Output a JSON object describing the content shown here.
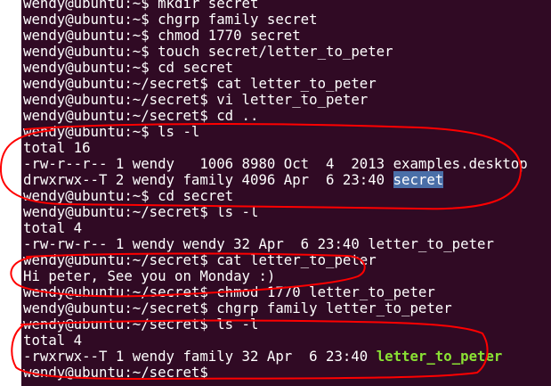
{
  "terminal": {
    "background": "#300a24",
    "text_color": "#ffffff",
    "highlight_color": "#4a6fa8",
    "executable_color": "#8ae234",
    "lines": [
      {
        "segments": [
          {
            "text": "wendy@ubuntu:~$ mkdir secret",
            "style": "normal"
          }
        ]
      },
      {
        "segments": [
          {
            "text": "wendy@ubuntu:~$ chgrp family secret",
            "style": "normal"
          }
        ]
      },
      {
        "segments": [
          {
            "text": "wendy@ubuntu:~$ chmod 1770 secret",
            "style": "normal"
          }
        ]
      },
      {
        "segments": [
          {
            "text": "wendy@ubuntu:~$ touch secret/letter_to_peter",
            "style": "normal"
          }
        ]
      },
      {
        "segments": [
          {
            "text": "wendy@ubuntu:~$ cd secret",
            "style": "normal"
          }
        ]
      },
      {
        "segments": [
          {
            "text": "wendy@ubuntu:~/secret$ cat letter_to_peter",
            "style": "normal"
          }
        ]
      },
      {
        "segments": [
          {
            "text": "wendy@ubuntu:~/secret$ vi letter_to_peter",
            "style": "normal"
          }
        ]
      },
      {
        "segments": [
          {
            "text": "wendy@ubuntu:~/secret$ cd ..",
            "style": "normal"
          }
        ]
      },
      {
        "segments": [
          {
            "text": "wendy@ubuntu:~$ ls -l",
            "style": "normal"
          }
        ]
      },
      {
        "segments": [
          {
            "text": "total 16",
            "style": "normal"
          }
        ]
      },
      {
        "segments": [
          {
            "text": "-rw-r--r-- 1 wendy   1006 8980 Oct  4  2013 examples.desktop",
            "style": "normal"
          }
        ]
      },
      {
        "segments": [
          {
            "text": "drwxrwx--T 2 wendy family 4096 Apr  6 23:40 ",
            "style": "normal"
          },
          {
            "text": "secret",
            "style": "highlight"
          }
        ]
      },
      {
        "segments": [
          {
            "text": "wendy@ubuntu:~$ cd secret",
            "style": "normal"
          }
        ]
      },
      {
        "segments": [
          {
            "text": "wendy@ubuntu:~/secret$ ls -l",
            "style": "normal"
          }
        ]
      },
      {
        "segments": [
          {
            "text": "total 4",
            "style": "normal"
          }
        ]
      },
      {
        "segments": [
          {
            "text": "-rw-rw-r-- 1 wendy wendy 32 Apr  6 23:40 letter_to_peter",
            "style": "normal"
          }
        ]
      },
      {
        "segments": [
          {
            "text": "wendy@ubuntu:~/secret$ cat letter_to_peter",
            "style": "normal"
          }
        ]
      },
      {
        "segments": [
          {
            "text": "Hi peter, See you on Monday :)",
            "style": "normal"
          }
        ]
      },
      {
        "segments": [
          {
            "text": "wendy@ubuntu:~/secret$ chmod 1770 letter_to_peter",
            "style": "normal"
          }
        ]
      },
      {
        "segments": [
          {
            "text": "wendy@ubuntu:~/secret$ chgrp family letter_to_peter",
            "style": "normal"
          }
        ]
      },
      {
        "segments": [
          {
            "text": "wendy@ubuntu:~/secret$ ls -l",
            "style": "normal"
          }
        ]
      },
      {
        "segments": [
          {
            "text": "total 4",
            "style": "normal"
          }
        ]
      },
      {
        "segments": [
          {
            "text": "-rwxrwx--T 1 wendy family 32 Apr  6 23:40 ",
            "style": "normal"
          },
          {
            "text": "letter_to_peter",
            "style": "executable"
          }
        ]
      },
      {
        "segments": [
          {
            "text": "wendy@ubuntu:~/secret$ ",
            "style": "normal"
          }
        ]
      }
    ]
  },
  "annotations": {
    "stroke_color": "#ff0000",
    "marks": [
      "red-circle",
      "red-circle",
      "red-circle"
    ]
  }
}
